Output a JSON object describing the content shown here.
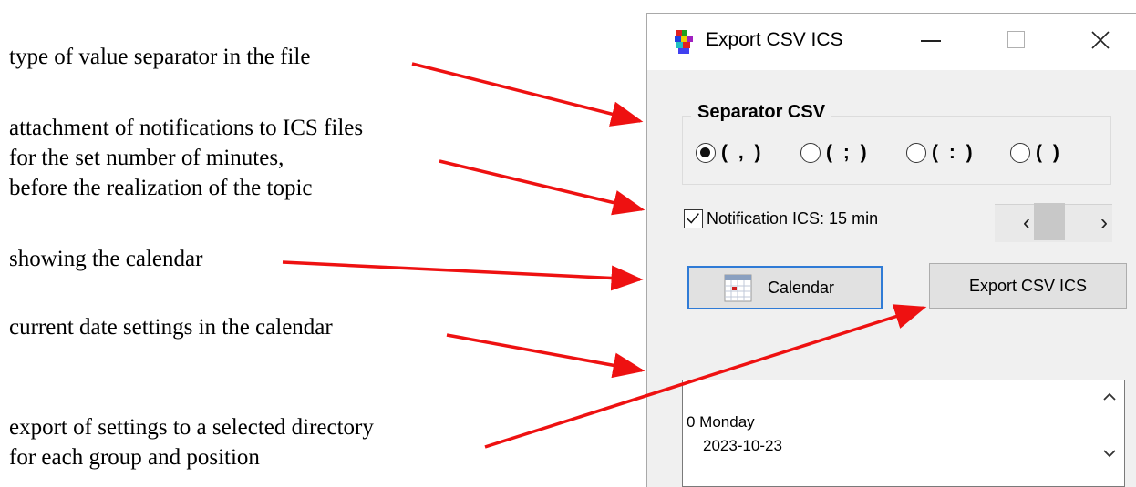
{
  "annotations": [
    {
      "id": "separator",
      "lines": [
        "type of value separator in the file"
      ]
    },
    {
      "id": "notification",
      "lines": [
        "attachment of notifications to ICS files",
        "for the set number of minutes,",
        "before the realization of the topic"
      ]
    },
    {
      "id": "calendar",
      "lines": [
        "showing the calendar"
      ]
    },
    {
      "id": "date",
      "lines": [
        "current date settings in the calendar"
      ]
    },
    {
      "id": "export",
      "lines": [
        "export of settings to a selected directory",
        "for each group and position"
      ]
    }
  ],
  "window": {
    "title": "Export  CSV ICS",
    "icon": "app-icon-multicolor",
    "controls": {
      "minimize": "minimize-icon",
      "maximize": "maximize-icon",
      "close": "close-icon"
    }
  },
  "separator_group": {
    "label": "Separator  CSV",
    "options": [
      "( , )",
      "( ; )",
      "( : )",
      "(   )"
    ],
    "selected_index": 0
  },
  "notification": {
    "checked": true,
    "label": "Notification ICS: 15 min",
    "scroll_left": "‹",
    "scroll_right": "›"
  },
  "buttons": {
    "calendar": "Calendar",
    "calendar_icon": "calendar-icon",
    "export": "Export  CSV ICS"
  },
  "listbox": {
    "line1": "0 Monday",
    "line2": "2023-10-23"
  },
  "colors": {
    "arrow": "#ee1111",
    "window_bg": "#f0f0f0",
    "focus_border": "#2f7bd6"
  }
}
